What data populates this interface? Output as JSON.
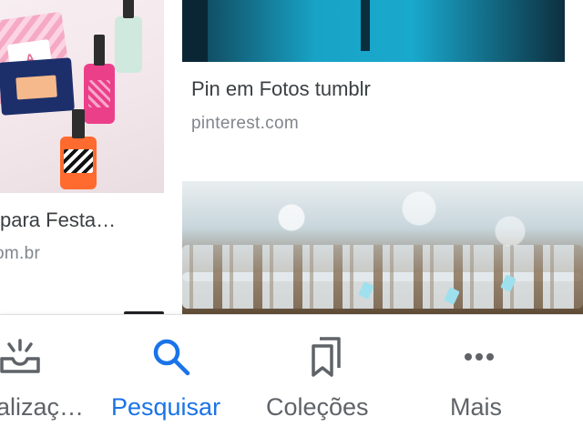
{
  "results": [
    {
      "title": " para Festa…",
      "source": "om.br"
    },
    {
      "title": "Pin em Fotos tumblr",
      "source": "pinterest.com"
    },
    {
      "title": "",
      "source": ""
    }
  ],
  "thumbnails": {
    "left_tag_letter": "A"
  },
  "bottom_nav": {
    "items": [
      {
        "label": "alizaç…",
        "icon": "updates-tray-icon",
        "active": false
      },
      {
        "label": "Pesquisar",
        "icon": "search-icon",
        "active": true
      },
      {
        "label": "Coleções",
        "icon": "bookmarks-icon",
        "active": false
      },
      {
        "label": "Mais",
        "icon": "more-horizontal-icon",
        "active": false
      }
    ]
  },
  "colors": {
    "active": "#1a73e8",
    "inactive": "#5f6368",
    "title_text": "#3c4043",
    "source_text": "#80868b"
  }
}
